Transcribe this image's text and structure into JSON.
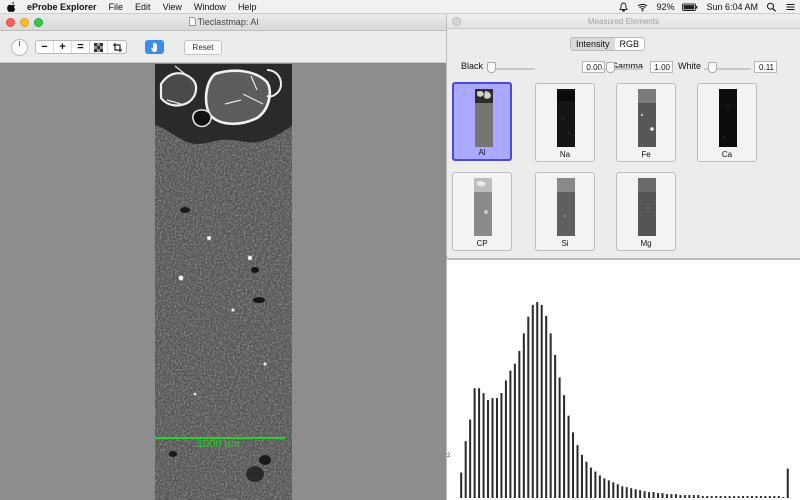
{
  "menubar": {
    "app_name": "eProbe Explorer",
    "items": [
      "File",
      "Edit",
      "View",
      "Window",
      "Help"
    ],
    "battery": "92%",
    "clock": "Sun 6:04 AM"
  },
  "map_window": {
    "title": "Tieclastmap: Al",
    "toolbar": {
      "zoom_out": "−",
      "zoom_in": "+",
      "zoom_fit": "=",
      "reset_label": "Reset"
    },
    "scale_bar_label": "1000 µm"
  },
  "elements_window": {
    "title": "Measured Elements",
    "modes": [
      "Intensity",
      "RGB"
    ],
    "selected_mode": "Intensity",
    "black": {
      "label": "Black",
      "value": "0.00",
      "level": 0.0
    },
    "gamma": {
      "label": "Gamma",
      "value": "1.00",
      "level": 0.5
    },
    "white": {
      "label": "White",
      "value": "0.11",
      "level": 0.11
    },
    "tiles": [
      {
        "label": "Al",
        "selected": true
      },
      {
        "label": "Na",
        "selected": false
      },
      {
        "label": "Fe",
        "selected": false
      },
      {
        "label": "Ca",
        "selected": false
      },
      {
        "label": "CP",
        "selected": false
      },
      {
        "label": "Si",
        "selected": false
      },
      {
        "label": "Mg",
        "selected": false
      }
    ]
  },
  "histogram": {
    "tick_label": "2"
  },
  "chart_data": {
    "type": "bar",
    "values": [
      0,
      0,
      0,
      0,
      0,
      26,
      0,
      58,
      0,
      80,
      0,
      112,
      0,
      112,
      0,
      107,
      0,
      100,
      0,
      102,
      0,
      102,
      0,
      107,
      0,
      120,
      0,
      130,
      0,
      137,
      0,
      150,
      0,
      168,
      0,
      185,
      0,
      197,
      0,
      200,
      0,
      197,
      0,
      186,
      0,
      168,
      0,
      146,
      0,
      123,
      0,
      105,
      0,
      84,
      0,
      67,
      0,
      54,
      0,
      44,
      0,
      37,
      0,
      31,
      0,
      27,
      0,
      23,
      0,
      20,
      0,
      18,
      0,
      16,
      0,
      14,
      0,
      12,
      0,
      11,
      0,
      10,
      0,
      9,
      0,
      8,
      0,
      7,
      0,
      6,
      0,
      6,
      0,
      5,
      0,
      5,
      0,
      4,
      0,
      4,
      0,
      4,
      0,
      3,
      0,
      3,
      0,
      3,
      0,
      3,
      0,
      3,
      0,
      2,
      0,
      2,
      0,
      2,
      0,
      2,
      0,
      2,
      0,
      2,
      0,
      2,
      0,
      2,
      0,
      2,
      0,
      2,
      0,
      2,
      0,
      2,
      0,
      2,
      0,
      2,
      0,
      2,
      0,
      2,
      0,
      2,
      0,
      2,
      0,
      1,
      0,
      30
    ],
    "ylim": [
      0,
      200
    ]
  }
}
